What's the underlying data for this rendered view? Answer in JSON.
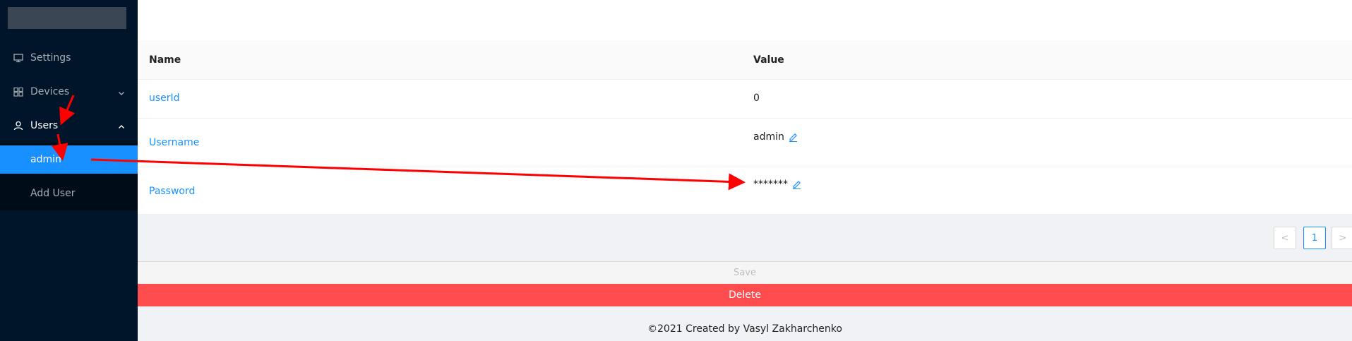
{
  "sidebar": {
    "items": [
      {
        "label": "Settings",
        "icon": "desktop-icon"
      },
      {
        "label": "Devices",
        "icon": "devices-icon"
      },
      {
        "label": "Users",
        "icon": "user-icon"
      }
    ],
    "users_submenu": [
      {
        "label": "admin",
        "selected": true
      },
      {
        "label": "Add User",
        "selected": false
      }
    ]
  },
  "table": {
    "headers": [
      "Name",
      "Value"
    ],
    "rows": [
      {
        "name": "userId",
        "value": "0",
        "editable": false
      },
      {
        "name": "Username",
        "value": "admin",
        "editable": true
      },
      {
        "name": "Password",
        "value": "*******",
        "editable": true
      }
    ]
  },
  "pagination": {
    "current": "1",
    "prev": "<",
    "next": ">"
  },
  "actions": {
    "save_label": "Save",
    "delete_label": "Delete"
  },
  "footer": {
    "text": "©2021 Created by Vasyl Zakharchenko"
  },
  "colors": {
    "sidebar_bg": "#001529",
    "accent": "#1890ff",
    "danger": "#ff4d4f",
    "annotation_arrow": "#ff0000"
  }
}
